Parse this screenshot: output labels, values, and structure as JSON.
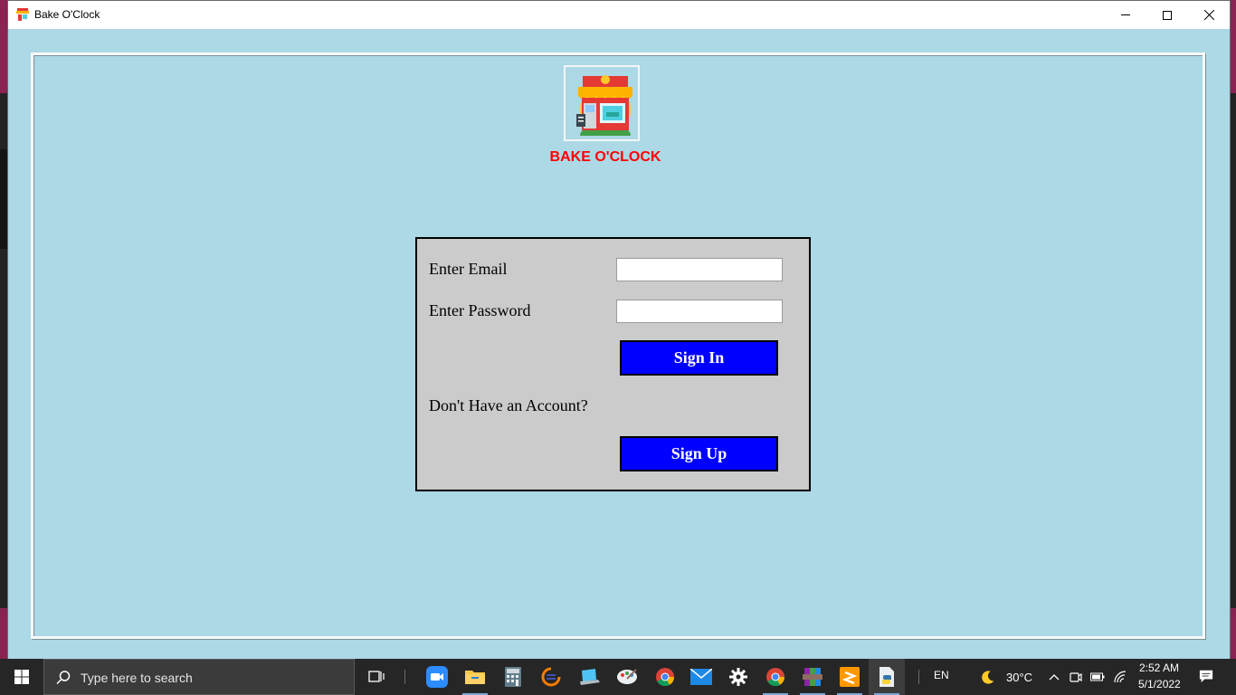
{
  "window": {
    "title": "Bake O'Clock"
  },
  "brand": {
    "name": "BAKE O'CLOCK"
  },
  "login": {
    "email_label": "Enter Email",
    "email_value": "",
    "password_label": "Enter Password",
    "password_value": "",
    "sign_in_label": "Sign In",
    "account_prompt": "Don't Have an Account?",
    "sign_up_label": "Sign Up"
  },
  "taskbar": {
    "search_placeholder": "Type here to search",
    "pinned": [
      "task-view-icon",
      "zoom-icon",
      "file-explorer-icon",
      "calculator-icon",
      "eclipse-icon",
      "laptop-icon",
      "paint-icon",
      "chrome-icon",
      "mail-icon",
      "settings-icon",
      "chrome-icon",
      "winrar-icon",
      "sublime-icon",
      "python-idle-icon"
    ],
    "language": "EN",
    "weather": "30°C",
    "time": "2:52 AM",
    "date": "5/1/2022"
  },
  "colors": {
    "background": "#add8e6",
    "panel": "#cbcbcb",
    "button": "#0000ff",
    "brand_text": "#ff0000"
  }
}
